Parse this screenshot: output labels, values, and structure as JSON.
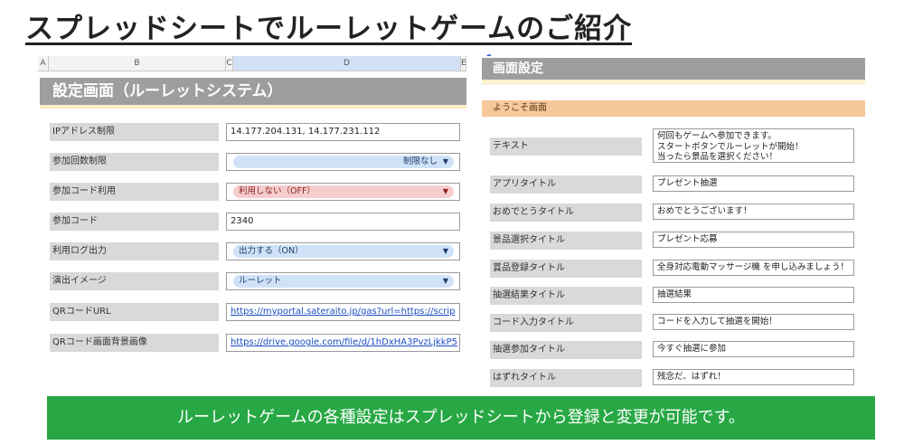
{
  "page": {
    "title": "スプレッドシートでルーレットゲームのご紹介",
    "footer": "ルーレットゲームの各種設定はスプレッドシートから登録と変更が可能です。"
  },
  "left_sheet": {
    "columns": [
      "A",
      "B",
      "C",
      "D",
      "E"
    ],
    "banner": "設定画面（ルーレットシステム）",
    "rows": [
      {
        "label": "IPアドレス制限",
        "value": "14.177.204.131, 14.177.231.112"
      },
      {
        "label": "参加回数制限",
        "value": "制限なし"
      },
      {
        "label": "参加コード利用",
        "value": "利用しない（OFF）"
      },
      {
        "label": "参加コード",
        "value": "2340"
      },
      {
        "label": "利用ログ出力",
        "value": "出力する（ON）"
      },
      {
        "label": "演出イメージ",
        "value": "ルーレット"
      },
      {
        "label": "QRコードURL",
        "value": "https://myportal.sateraito.jp/gas?url=https://scrip"
      },
      {
        "label": "QRコード画面背景画像",
        "value": "https://drive.google.com/file/d/1hDxHA3PvzLjkkP5"
      }
    ]
  },
  "right_sheet": {
    "banner": "画面設定",
    "section": "ようこそ画面",
    "rows": [
      {
        "label": "テキスト",
        "lines": [
          "何回もゲームへ参加できます。",
          "スタートボタンでルーレットが開始！",
          "当ったら景品を選択ください！"
        ]
      },
      {
        "label": "アプリタイトル",
        "value": "プレゼント抽選"
      },
      {
        "label": "おめでとうタイトル",
        "value": "おめでとうございます！"
      },
      {
        "label": "景品選択タイトル",
        "value": "プレゼント応募"
      },
      {
        "label": "賞品登録タイトル",
        "value": "全身対応電動マッサージ機 を申し込みましょう！"
      },
      {
        "label": "抽選結果タイトル",
        "value": "抽選結果"
      },
      {
        "label": "コード入力タイトル",
        "value": "コードを入力して抽選を開始！"
      },
      {
        "label": "抽選参加タイトル",
        "value": "今すぐ抽選に参加"
      },
      {
        "label": "はずれタイトル",
        "value": "残念だ、はずれ！"
      }
    ]
  },
  "colors": {
    "banner": "#9e9e9e",
    "section": "#f7c89a",
    "footer": "#27a844",
    "link": "#1a4cc2",
    "chip_blue": "#cfe2f7",
    "chip_red": "#f6cdcd"
  },
  "icons": [
    "dropdown-caret-icon"
  ]
}
